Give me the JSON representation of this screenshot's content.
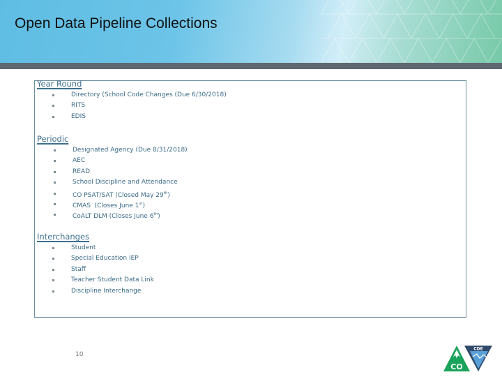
{
  "slide": {
    "title": "Open Data Pipeline Collections",
    "page_number": "10",
    "logo": {
      "name": "co-cde-logo",
      "text_left": "CO",
      "text_right": "CDE",
      "colors": {
        "green": "#1aa35a",
        "navy": "#2f4a6b",
        "sky": "#5aa0d8"
      }
    }
  },
  "theme": {
    "heading_color": "#3e6f8e",
    "text_color": "#3a6b88",
    "border_color": "#6d8fa0",
    "header_bar_color": "#5f6870"
  },
  "sections": [
    {
      "heading": "Year Round",
      "items": [
        {
          "text": "Directory (School Code Changes (Due 6/30/2018)"
        },
        {
          "text": "RITS"
        },
        {
          "text": "EDIS"
        }
      ]
    },
    {
      "heading": "Periodic",
      "items": [
        {
          "text": "Designated Agency (Due 8/31/2018)"
        },
        {
          "text": "AEC"
        },
        {
          "text": "READ"
        },
        {
          "text": "School Discipline and Attendance"
        },
        {
          "text": "CO PSAT/SAT (Closed May 29",
          "sup": "th",
          "tail": ")"
        },
        {
          "text": "CMAS  (Closes June 1",
          "sup": "st",
          "tail": ")"
        },
        {
          "text": "CoALT DLM (Closes June 6",
          "sup": "th",
          "tail": ")"
        }
      ]
    },
    {
      "heading": "Interchanges",
      "items": [
        {
          "text": "Student"
        },
        {
          "text": "Special Education IEP"
        },
        {
          "text": "Staff"
        },
        {
          "text": "Teacher Student Data Link"
        },
        {
          "text": "Discipline Interchange"
        }
      ]
    }
  ]
}
